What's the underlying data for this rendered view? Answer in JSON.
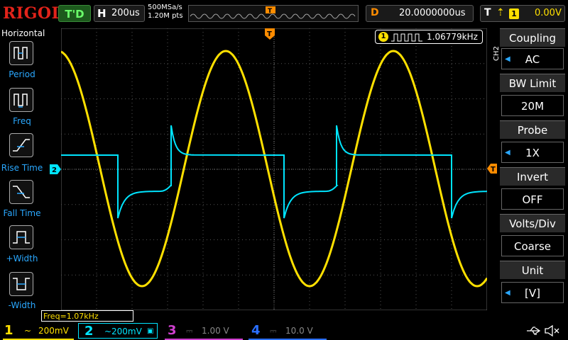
{
  "brand": "RIGOL",
  "top": {
    "run_status": "T'D",
    "h_label": "H",
    "timebase": "200us",
    "sample_rate": "500MSa/s",
    "mem_depth": "1.20M pts",
    "delay_label": "D",
    "delay_value": "20.0000000us",
    "trig_label": "T",
    "trig_channel": "1",
    "trig_level": "0.00V"
  },
  "left_panel": {
    "title": "Horizontal",
    "items": [
      {
        "label": "Period",
        "icon": "period-icon"
      },
      {
        "label": "Freq",
        "icon": "freq-icon"
      },
      {
        "label": "Rise Time",
        "icon": "rise-time-icon"
      },
      {
        "label": "Fall Time",
        "icon": "fall-time-icon"
      },
      {
        "label": "+Width",
        "icon": "pos-width-icon"
      },
      {
        "label": "-Width",
        "icon": "neg-width-icon"
      }
    ]
  },
  "measurement": {
    "channel": "1",
    "value": "1.06779kHz"
  },
  "right_menu": {
    "channel_label": "CH2",
    "items": [
      {
        "title": "Coupling",
        "value": "AC"
      },
      {
        "title": "BW Limit",
        "value": "20M"
      },
      {
        "title": "Probe",
        "value": "1X"
      },
      {
        "title": "Invert",
        "value": "OFF"
      },
      {
        "title": "Volts/Div",
        "value": "Coarse"
      },
      {
        "title": "Unit",
        "value": "[V]"
      }
    ]
  },
  "freq_strip": "Freq=1.07kHz",
  "channels": [
    {
      "num": "1",
      "scale": "200mV",
      "color": "#ffe000"
    },
    {
      "num": "2",
      "scale": "200mV",
      "color": "#00e5ff"
    },
    {
      "num": "3",
      "scale": "1.00 V",
      "color": "#d040d0"
    },
    {
      "num": "4",
      "scale": "10.0 V",
      "color": "#2a6fff"
    }
  ],
  "markers": {
    "trigger_t": "T",
    "ch2_marker": "2"
  },
  "colors": {
    "ch1": "#ffe000",
    "ch2": "#00e5ff",
    "accent": "#2aa8ff",
    "trigger": "#ff8c00"
  }
}
